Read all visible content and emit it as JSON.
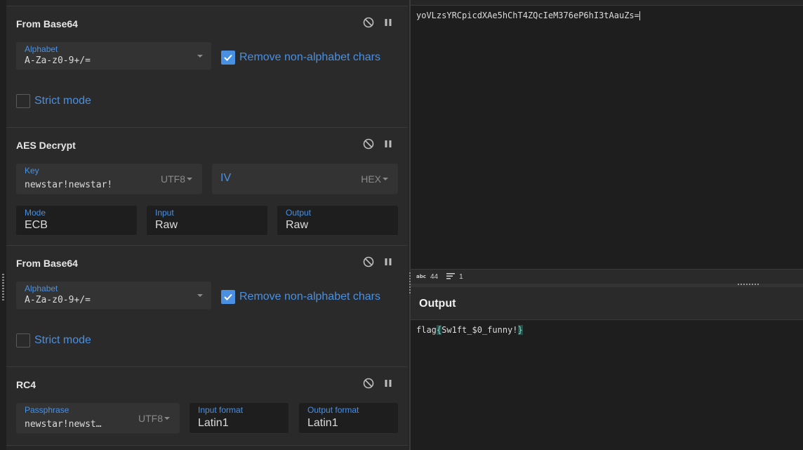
{
  "recipe": {
    "ops": [
      {
        "title": "From Base64",
        "alphabet_label": "Alphabet",
        "alphabet_value": "A-Za-z0-9+/=",
        "remove_label": "Remove non-alphabet chars",
        "strict_label": "Strict mode"
      },
      {
        "title": "AES Decrypt",
        "key_label": "Key",
        "key_value": "newstar!newstar!",
        "key_encoding": "UTF8",
        "iv_label": "IV",
        "iv_encoding": "HEX",
        "mode_label": "Mode",
        "mode_value": "ECB",
        "input_label": "Input",
        "input_value": "Raw",
        "output_label": "Output",
        "output_value": "Raw"
      },
      {
        "title": "From Base64",
        "alphabet_label": "Alphabet",
        "alphabet_value": "A-Za-z0-9+/=",
        "remove_label": "Remove non-alphabet chars",
        "strict_label": "Strict mode"
      },
      {
        "title": "RC4",
        "pass_label": "Passphrase",
        "pass_value": "newstar!newst…",
        "pass_encoding": "UTF8",
        "inform_label": "Input format",
        "inform_value": "Latin1",
        "outform_label": "Output format",
        "outform_value": "Latin1"
      }
    ]
  },
  "input": {
    "text": "yoVLzsYRCpicdXAe5hChT4ZQcIeM376eP6hI3tAauZs="
  },
  "status": {
    "length_icon": "abc-icon",
    "length": "44",
    "lines_icon": "lines-icon",
    "lines": "1"
  },
  "output": {
    "title": "Output",
    "prefix": "flag",
    "open_brace": "{",
    "body": "Sw1ft_$0_funny!",
    "close_brace": "}"
  },
  "colors": {
    "accent": "#4a90e2",
    "background": "#1e1e1e",
    "panel": "#2a2a2a"
  }
}
